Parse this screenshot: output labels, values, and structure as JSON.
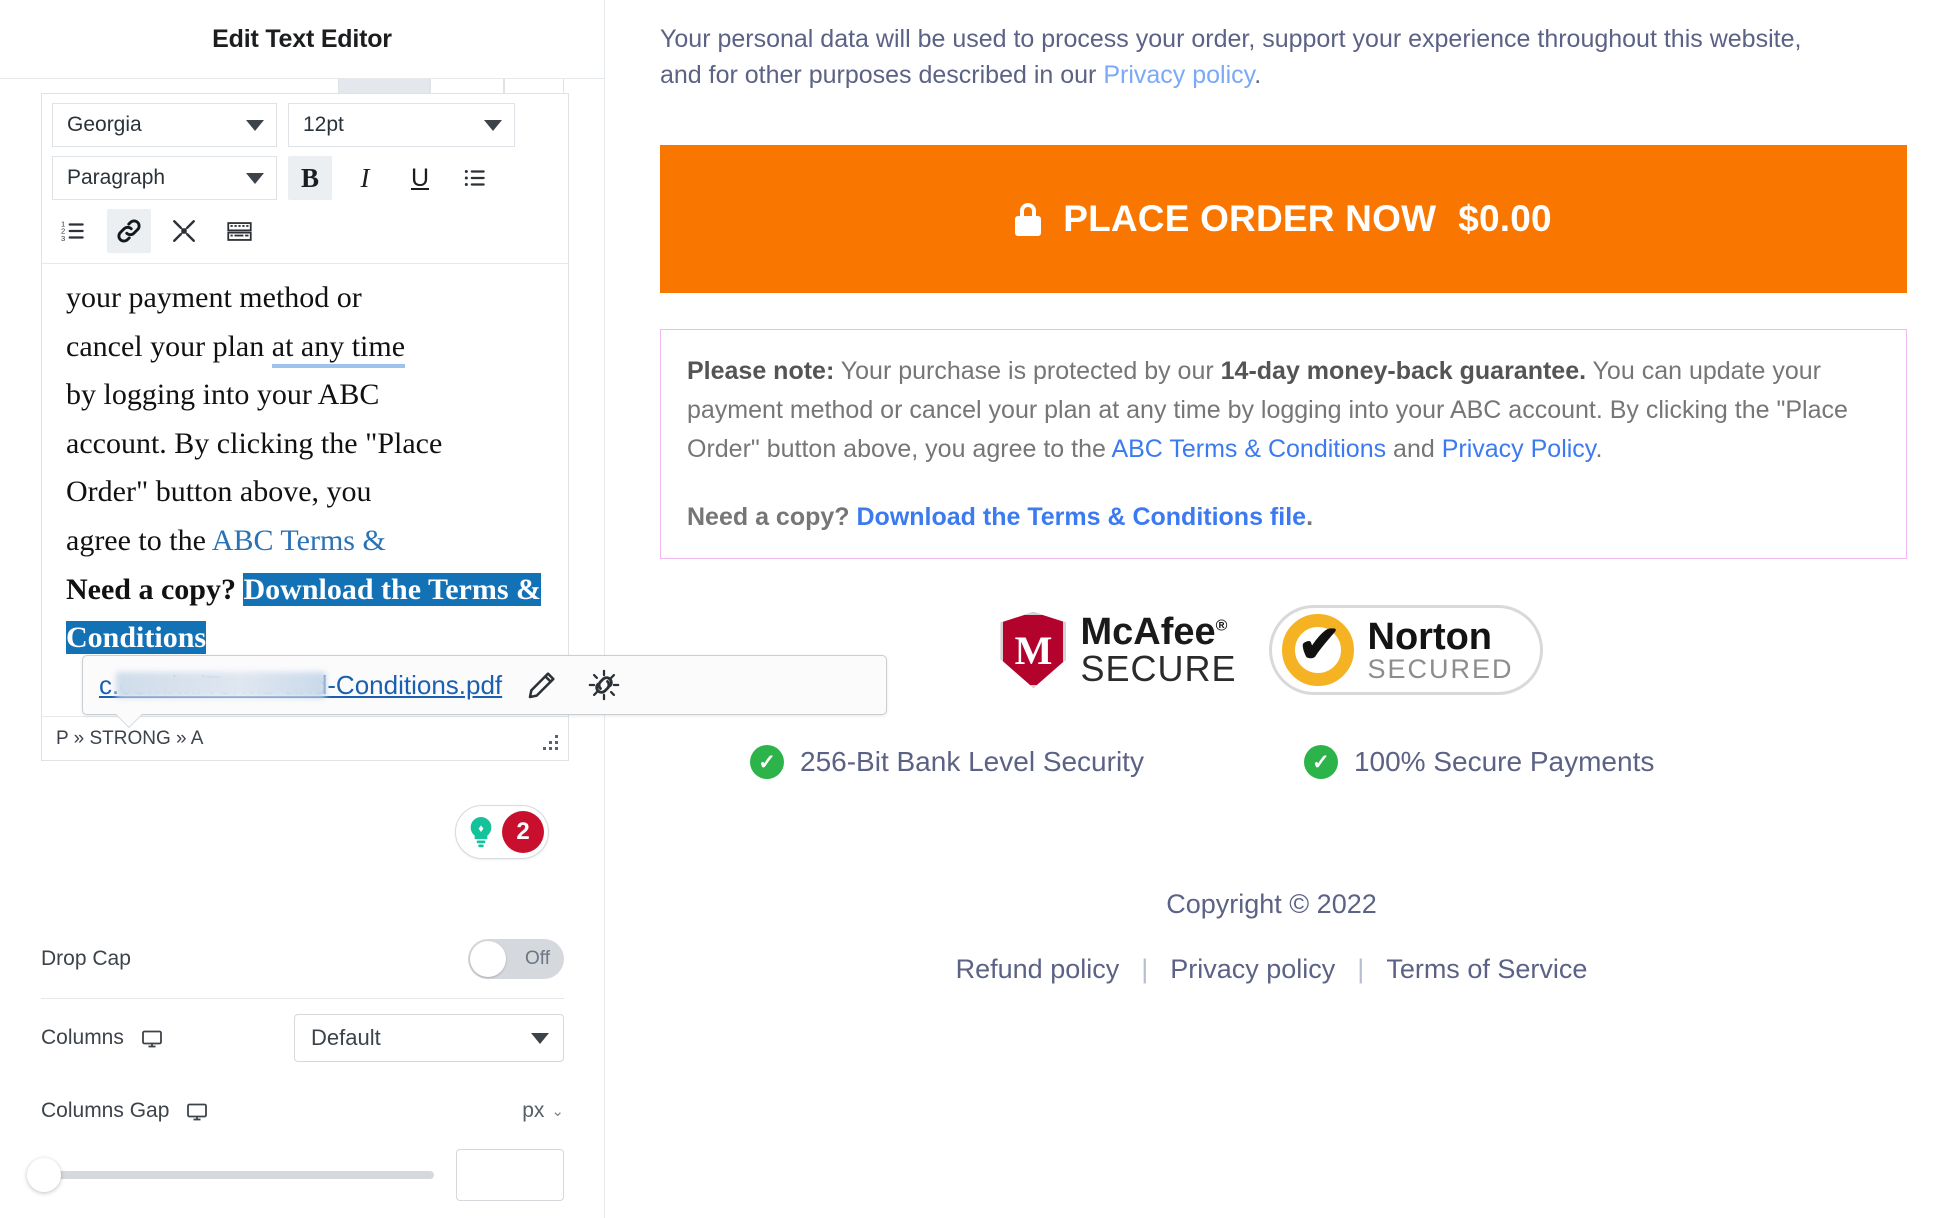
{
  "sidebar": {
    "title": "Edit Text Editor",
    "toolbar": {
      "font_family": "Georgia",
      "font_size": "12pt",
      "block_format": "Paragraph",
      "bold_label": "B",
      "italic_label": "I",
      "underline_label": "U",
      "bullet_list_icon": "bullet-list-icon",
      "numbered_list_icon": "numbered-list-icon",
      "link_icon": "link-icon",
      "fullscreen_icon": "fullscreen-icon",
      "keyboard_icon": "keyboard-icon"
    },
    "editor_text": {
      "line1": "your payment method or",
      "line2_a": "cancel your plan ",
      "line2_b": "at any time",
      "line3": "by logging into your ABC",
      "line4": "account. By clicking the \"Place",
      "line5_a": "Order\" button above, you",
      "line5_b": "agree to the ",
      "line5_link": "ABC Terms &",
      "need_copy_bold": "Need a copy? ",
      "selected_link": "Download the Terms & Conditions"
    },
    "statusbar": "P » STRONG » A",
    "link_popup": {
      "url": ".com/.../Terms-and-Conditions.pdf",
      "url_prefix": "c",
      "edit_icon": "pencil-icon",
      "unlink_icon": "unlink-icon"
    },
    "grammarly": {
      "bulb_icon": "lightbulb-icon",
      "issue_count": "2"
    },
    "controls": {
      "drop_cap_label": "Drop Cap",
      "drop_cap_state": "Off",
      "columns_label": "Columns",
      "columns_value": "Default",
      "columns_gap_label": "Columns Gap",
      "columns_gap_unit": "px",
      "device_icon": "desktop-monitor-icon"
    }
  },
  "preview": {
    "privacy_note": {
      "text_before": "Your personal data will be used to process your order, support your experience throughout this website, and for other purposes described in our ",
      "link": "Privacy policy",
      "text_after": "."
    },
    "order_button": {
      "lock_icon": "lock-icon",
      "label": "PLACE ORDER NOW",
      "price": "$0.00"
    },
    "note_box": {
      "lead": "Please note:",
      "t1": " Your purchase is protected by our ",
      "guarantee": "14-day money-back guarantee.",
      "t2": " You can update your payment method or cancel your plan at any time by logging into your ABC account. By clicking the \"Place Order\" button above, you agree to the ",
      "link1": "ABC Terms & Conditions",
      "t3": " and ",
      "link2": "Privacy Policy",
      "t4": ".",
      "need_copy_label": "Need a copy? ",
      "need_copy_link": "Download the Terms & Conditions file",
      "need_copy_period": "."
    },
    "trust_badges": {
      "mcafee_mark": "M",
      "mcafee_name": "McAfee",
      "mcafee_reg": "®",
      "mcafee_secure": "SECURE",
      "norton_check": "✔",
      "norton_name": "Norton",
      "norton_secured": "SECURED"
    },
    "security_items": [
      {
        "icon": "check-circle-icon",
        "label": "256-Bit Bank Level Security"
      },
      {
        "icon": "check-circle-icon",
        "label": "100% Secure Payments"
      }
    ],
    "footer": {
      "copyright": "Copyright © 2022",
      "links": [
        {
          "label": "Refund policy"
        },
        {
          "label": "Privacy policy"
        },
        {
          "label": "Terms of Service"
        }
      ],
      "separator": "|"
    }
  },
  "colors": {
    "order_button_bg": "#f97700",
    "note_border": "#f2b8f2",
    "link_blue": "#3b7af0",
    "selection_blue": "#1272b5",
    "grammarly_red": "#c8102e",
    "grammarly_green": "#15c39a",
    "check_green": "#2cb34a",
    "text_purple": "#5c6286"
  }
}
